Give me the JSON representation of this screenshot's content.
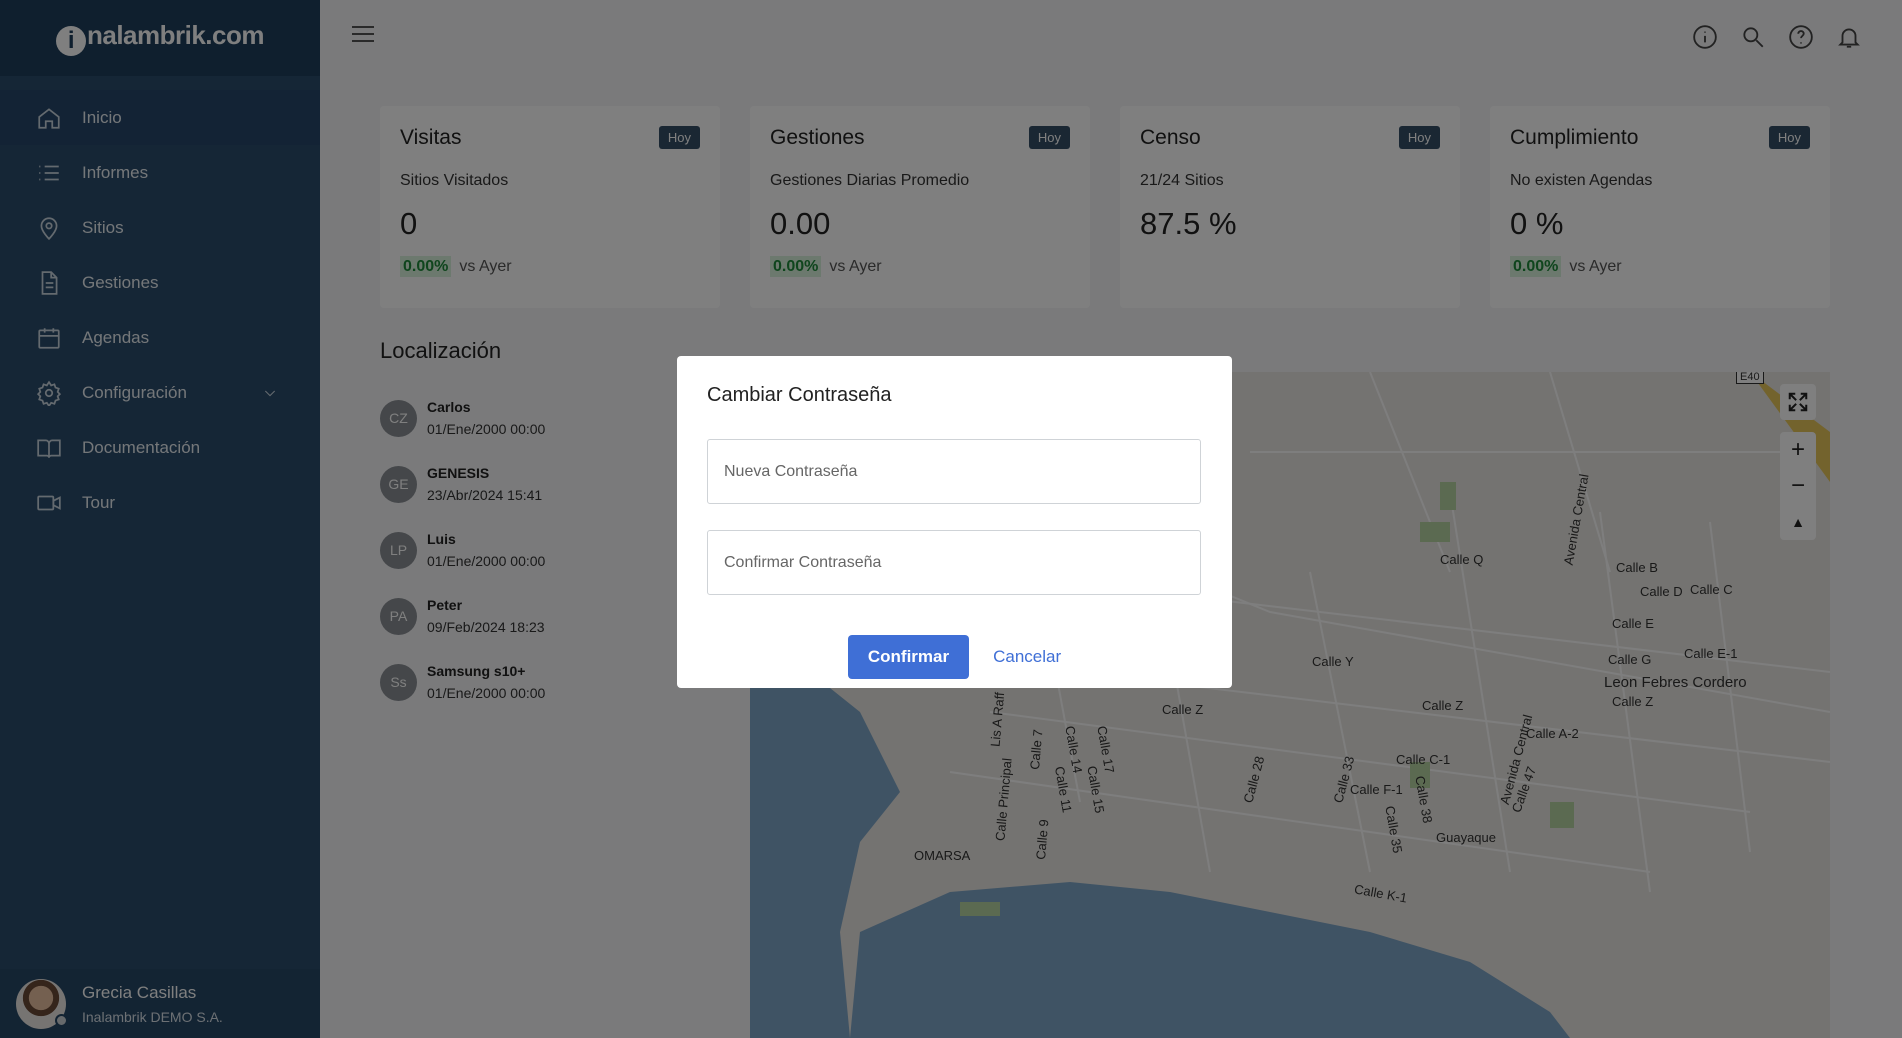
{
  "brand": {
    "logo_ball": "i",
    "logo_rest": "nalambrik.com"
  },
  "sidebar": {
    "items": [
      {
        "label": "Inicio",
        "icon": "home-icon"
      },
      {
        "label": "Informes",
        "icon": "list-icon"
      },
      {
        "label": "Sitios",
        "icon": "map-pin-icon"
      },
      {
        "label": "Gestiones",
        "icon": "document-icon"
      },
      {
        "label": "Agendas",
        "icon": "calendar-icon"
      },
      {
        "label": "Configuración",
        "icon": "gear-icon"
      },
      {
        "label": "Documentación",
        "icon": "book-icon"
      },
      {
        "label": "Tour",
        "icon": "video-icon"
      }
    ],
    "user": {
      "name": "Grecia Casillas",
      "org": "Inalambrik DEMO S.A."
    }
  },
  "cards": [
    {
      "title": "Visitas",
      "badge": "Hoy",
      "subtitle": "Sitios Visitados",
      "value": "0",
      "pct": "0.00%",
      "compare": "vs Ayer"
    },
    {
      "title": "Gestiones",
      "badge": "Hoy",
      "subtitle": "Gestiones Diarias Promedio",
      "value": "0.00",
      "pct": "0.00%",
      "compare": "vs Ayer"
    },
    {
      "title": "Censo",
      "badge": "Hoy",
      "subtitle": "21/24 Sitios",
      "value": "87.5 %",
      "pct": "",
      "compare": ""
    },
    {
      "title": "Cumplimiento",
      "badge": "Hoy",
      "subtitle": "No existen Agendas",
      "value": "0 %",
      "pct": "0.00%",
      "compare": "vs Ayer"
    }
  ],
  "localizacion": {
    "title": "Localización",
    "items": [
      {
        "initials": "CZ",
        "name": "Carlos",
        "date": "01/Ene/2000 00:00"
      },
      {
        "initials": "GE",
        "name": "GENESIS",
        "date": "23/Abr/2024 15:41"
      },
      {
        "initials": "LP",
        "name": "Luis",
        "date": "01/Ene/2000 00:00"
      },
      {
        "initials": "PA",
        "name": "Peter",
        "date": "09/Feb/2024 18:23"
      },
      {
        "initials": "Ss",
        "name": "Samsung s10+",
        "date": "01/Ene/2000 00:00"
      }
    ]
  },
  "map": {
    "labels": [
      "Calle Q",
      "Avenida Central",
      "Calle B",
      "Calle D",
      "Calle C",
      "Calle E",
      "Calle E-1",
      "Calle G",
      "Calle Y",
      "Leon Febres Cordero",
      "Calle Z",
      "Calle Z",
      "Calle Z",
      "Calle A-2",
      "Calle C-1",
      "Avenida Central",
      "Calle F-1",
      "Calle 28",
      "Calle 33",
      "Calle 38",
      "Calle 35",
      "Calle 47",
      "Guayaque",
      "Calle K-1",
      "OMARSA",
      "Calle Principal",
      "Lis A Raff",
      "Calle 7",
      "Calle 14",
      "Calle 11",
      "Calle 17",
      "Calle 15",
      "Calle 9",
      "E40"
    ],
    "controls": {
      "zoom_in": "+",
      "zoom_out": "−",
      "compass": "▲"
    }
  },
  "modal": {
    "title": "Cambiar Contraseña",
    "new_password_placeholder": "Nueva Contraseña",
    "confirm_password_placeholder": "Confirmar Contraseña",
    "confirm_label": "Confirmar",
    "cancel_label": "Cancelar"
  }
}
